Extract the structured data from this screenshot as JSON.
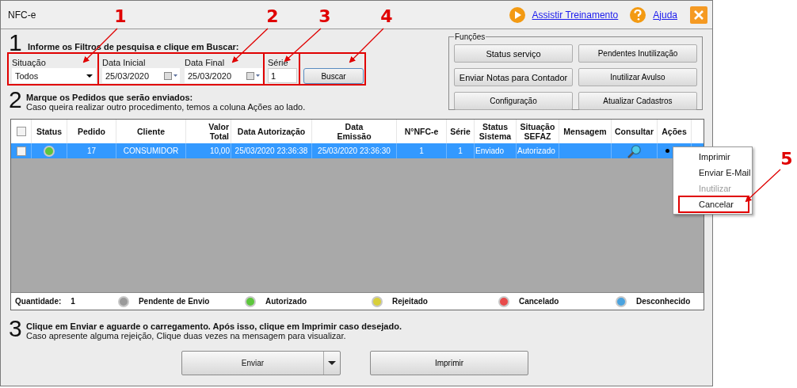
{
  "window": {
    "title": "NFC-e"
  },
  "header_links": [
    {
      "kind": "training",
      "label": "Assistir Treinamento"
    },
    {
      "kind": "help",
      "label": "Ajuda"
    }
  ],
  "step1": {
    "number": "1",
    "heading": "Informe os Filtros de pesquisa e clique em Buscar:",
    "situacao": {
      "label": "Situação",
      "value": "Todos"
    },
    "data_inicial": {
      "label": "Data Inicial",
      "value": "25/03/2020"
    },
    "data_final": {
      "label": "Data Final",
      "value": "25/03/2020"
    },
    "serie": {
      "label": "Série",
      "value": "1"
    },
    "search_button": "Buscar"
  },
  "functions": {
    "title": "Funções",
    "buttons": [
      "Status serviço",
      "Pendentes Inutilização",
      "Enviar Notas para Contador",
      "Inutilizar Avulso",
      "Configuração",
      "Atualizar Cadastros"
    ]
  },
  "step2": {
    "number": "2",
    "heading": "Marque os Pedidos que serão enviados:",
    "text": "Caso queira realizar outro procedimento, temos a coluna Ações ao lado."
  },
  "table": {
    "header_checked": false,
    "columns": [
      "Status",
      "Pedido",
      "Cliente",
      "Valor\nTotal",
      "Data Autorização",
      "Data\nEmissão",
      "N°NFC-e",
      "Série",
      "Status\nSistema",
      "Situação\nSEFAZ",
      "Mensagem",
      "Consultar",
      "Ações"
    ],
    "rows": [
      {
        "checked": false,
        "selected": true,
        "color": "#5cc63c",
        "pedido": "17",
        "cliente": "CONSUMIDOR",
        "valor_total": "10,00",
        "data_autorizacao": "25/03/2020 23:36:38",
        "data_emissao": "25/03/2020 23:36:30",
        "nfce": "1",
        "serie": "1",
        "status_sistema": "Enviado",
        "situacao_sefaz": "Autorizado"
      }
    ]
  },
  "context_menu": [
    {
      "label": "Imprimir",
      "disabled": false
    },
    {
      "label": "Enviar E-Mail",
      "disabled": false
    },
    {
      "label": "Inutilizar",
      "disabled": true
    },
    {
      "label": "Cancelar",
      "disabled": false
    }
  ],
  "legend": {
    "quantity_label": "Quantidade:",
    "quantity": "1",
    "items": [
      {
        "label": "Pendente de Envio",
        "color": "#9a9a9a"
      },
      {
        "label": "Autorizado",
        "color": "#5cc63c"
      },
      {
        "label": "Rejeitado",
        "color": "#d8cf3a"
      },
      {
        "label": "Cancelado",
        "color": "#e84b4b"
      },
      {
        "label": "Desconhecido",
        "color": "#4aa3df"
      }
    ]
  },
  "step3": {
    "number": "3",
    "heading": "Clique em Enviar e aguarde o carregamento. Após isso, clique em Imprimir caso desejado.",
    "text": "Caso apresente alguma rejeição, Clique duas vezes na mensagem para visualizar."
  },
  "buttons": {
    "send": "Enviar",
    "print": "Imprimir"
  },
  "annotations": [
    "1",
    "2",
    "3",
    "4",
    "5"
  ]
}
